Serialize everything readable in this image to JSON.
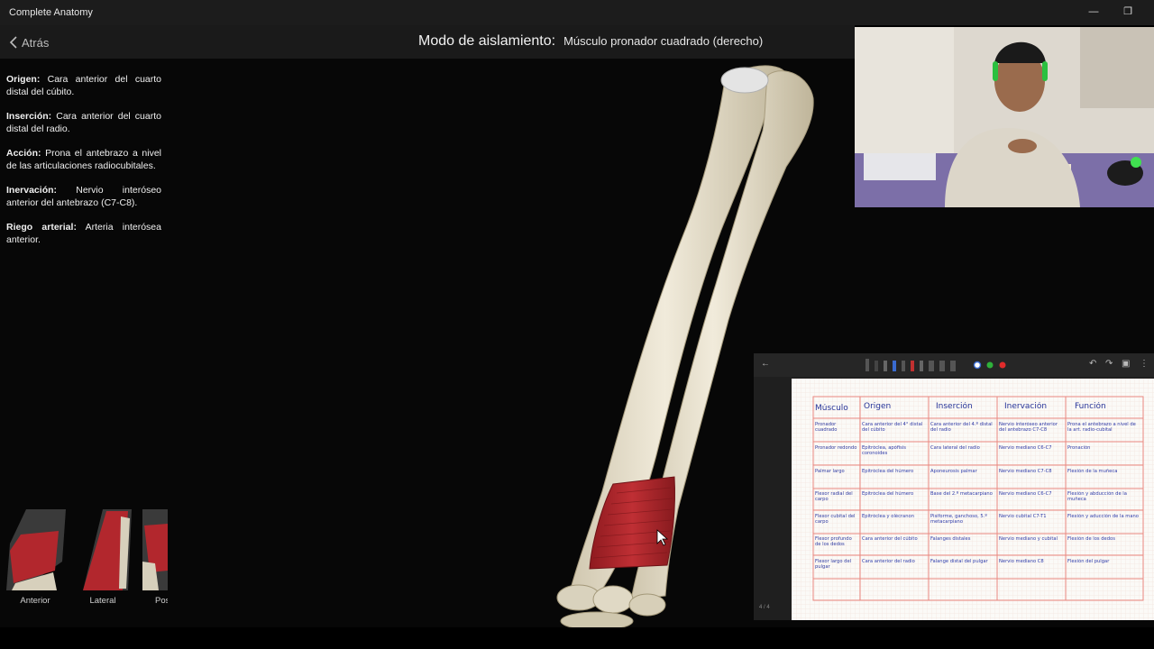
{
  "window": {
    "app_title": "Complete Anatomy"
  },
  "topbar": {
    "back_label": "Atrás",
    "mode_label": "Modo de aislamiento:",
    "mode_value": "Músculo pronador cuadrado (derecho)"
  },
  "info": [
    {
      "label": "Origen:",
      "text": "Cara anterior del cuarto distal del cúbito."
    },
    {
      "label": "Inserción:",
      "text": "Cara anterior del cuarto distal del radio."
    },
    {
      "label": "Acción:",
      "text": "Prona el antebrazo a nivel de las articulaciones radiocubitales."
    },
    {
      "label": "Inervación:",
      "text": "Nervio interóseo anterior del antebrazo (C7-C8)."
    },
    {
      "label": "Riego arterial:",
      "text": "Arteria interósea anterior."
    }
  ],
  "views": [
    {
      "label": "Anterior"
    },
    {
      "label": "Lateral"
    },
    {
      "label": "Pos"
    }
  ],
  "notes": {
    "page_counter": "4 / 4",
    "headers": [
      "Músculo",
      "Origen",
      "Inserción",
      "Inervación",
      "Función"
    ],
    "rows": [
      [
        "Pronador cuadrado",
        "Cara anterior del 4° distal del cúbito",
        "Cara anterior del 4.º distal del radio",
        "Nervio interóseo anterior del antebrazo C7-C8",
        "Prona el antebrazo a nivel de la art. radio-cubital"
      ],
      [
        "Pronador redondo",
        "Epitróclea, apófisis coronoides",
        "Cara lateral del radio",
        "Nervio mediano C6-C7",
        "Pronación"
      ],
      [
        "Palmar largo",
        "Epitróclea del húmero",
        "Aponeurosis palmar",
        "Nervio mediano C7-C8",
        "Flexión de la muñeca"
      ],
      [
        "Flexor radial del carpo",
        "Epitróclea del húmero",
        "Base del 2.º metacarpiano",
        "Nervio mediano C6-C7",
        "Flexión y abducción de la muñeca"
      ],
      [
        "Flexor cubital del carpo",
        "Epitróclea y olécranon",
        "Pisiforme, ganchoso, 5.º metacarpiano",
        "Nervio cubital C7-T1",
        "Flexión y aducción de la mano"
      ],
      [
        "Flexor profundo de los dedos",
        "Cara anterior del cúbito",
        "Falanges distales",
        "Nervio mediano y cubital",
        "Flexión de los dedos"
      ],
      [
        "Flexor largo del pulgar",
        "Cara anterior del radio",
        "Falange distal del pulgar",
        "Nervio mediano C8",
        "Flexión del pulgar"
      ]
    ]
  },
  "colors": {
    "muscle": "#b0262c",
    "bone": "#e9e2cf",
    "grid_red": "#e9877f",
    "ink_blue": "#2e3aa8"
  }
}
